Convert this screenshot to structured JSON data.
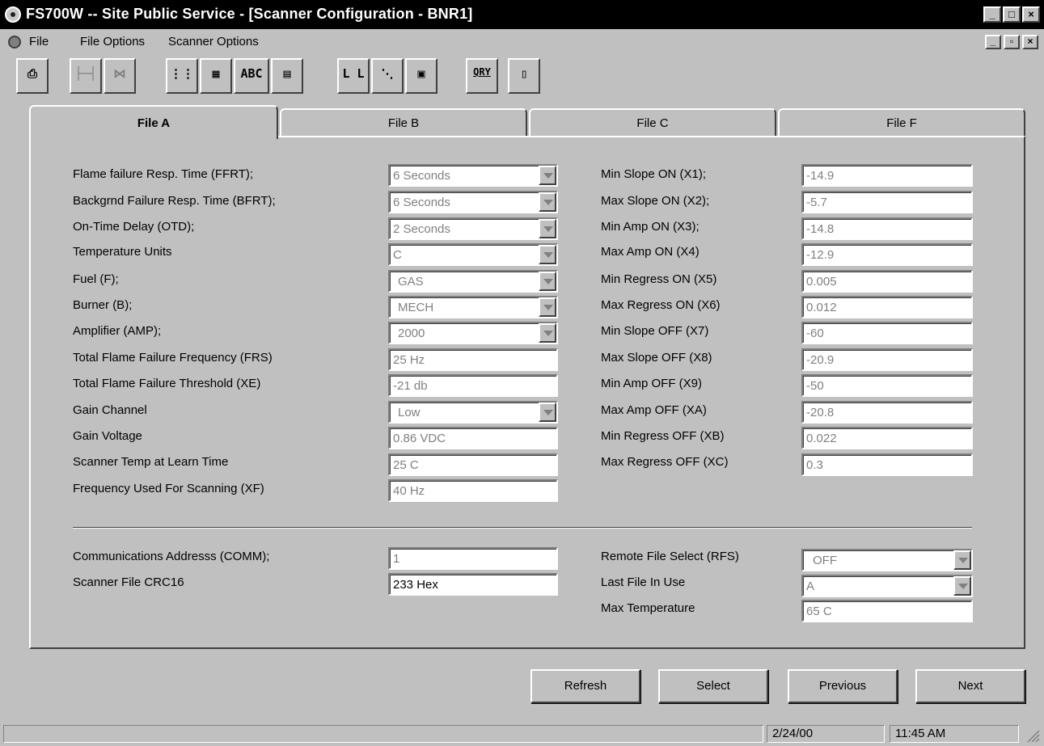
{
  "window": {
    "title": "FS700W -- Site Public Service - [Scanner Configuration - BNR1]",
    "controls": {
      "minimize": "_",
      "maximize": "□",
      "close": "×"
    }
  },
  "menu": {
    "items": [
      "File",
      "File Options",
      "Scanner Options"
    ],
    "mdi_controls": {
      "minimize": "_",
      "restore": "▫",
      "close": "×"
    }
  },
  "toolbar": {
    "buttons": [
      {
        "icon": "printer-icon",
        "glyph": "⎙"
      },
      {
        "icon": "connect-icon",
        "glyph": "├─┤"
      },
      {
        "icon": "disconnect-icon",
        "glyph": "⋈"
      },
      {
        "icon": "list-icon",
        "glyph": "⋮⋮"
      },
      {
        "icon": "data-grid-icon",
        "glyph": "▦"
      },
      {
        "icon": "text-icon",
        "glyph": "ABC"
      },
      {
        "icon": "table-icon",
        "glyph": "▤"
      },
      {
        "icon": "bars-icon",
        "glyph": "L L"
      },
      {
        "icon": "chart-icon",
        "glyph": "⋱"
      },
      {
        "icon": "window-icon",
        "glyph": "▣"
      },
      {
        "icon": "query-icon",
        "glyph": "QRY"
      },
      {
        "icon": "exit-door-icon",
        "glyph": "▯"
      }
    ]
  },
  "tabs": [
    "File A",
    "File B",
    "File C",
    "File F"
  ],
  "left_fields": [
    {
      "label": "Flame failure Resp. Time (FFRT);",
      "value": "6 Seconds",
      "dropdown": true
    },
    {
      "label": "Backgrnd Failure Resp. Time (BFRT);",
      "value": "6 Seconds",
      "dropdown": true
    },
    {
      "label": "On-Time Delay (OTD);",
      "value": "2 Seconds",
      "dropdown": true
    },
    {
      "label": "Temperature Units",
      "value": "C",
      "dropdown": true
    },
    {
      "label": "Fuel (F);",
      "value": "GAS",
      "dropdown": true
    },
    {
      "label": "Burner (B);",
      "value": "MECH",
      "dropdown": true
    },
    {
      "label": "Amplifier (AMP);",
      "value": "2000",
      "dropdown": true
    },
    {
      "label": "Total Flame Failure Frequency (FRS)",
      "value": "25 Hz",
      "dropdown": false
    },
    {
      "label": "Total Flame Failure Threshold (XE)",
      "value": "-21 db",
      "dropdown": false
    },
    {
      "label": "Gain Channel",
      "value": "Low",
      "dropdown": true
    },
    {
      "label": "Gain Voltage",
      "value": "0.86 VDC",
      "dropdown": false
    },
    {
      "label": "Scanner Temp at Learn Time",
      "value": "25 C",
      "dropdown": false
    },
    {
      "label": "Frequency Used For Scanning (XF)",
      "value": "40 Hz",
      "dropdown": false
    }
  ],
  "right_fields": [
    {
      "label": "Min Slope ON (X1);",
      "value": "-14.9"
    },
    {
      "label": "Max Slope ON (X2);",
      "value": "-5.7"
    },
    {
      "label": "Min Amp ON (X3);",
      "value": "-14.8"
    },
    {
      "label": "Max Amp ON (X4)",
      "value": "-12.9"
    },
    {
      "label": "Min Regress ON (X5)",
      "value": "0.005"
    },
    {
      "label": "Max Regress ON (X6)",
      "value": "0.012"
    },
    {
      "label": "Min Slope OFF (X7)",
      "value": "-60"
    },
    {
      "label": "Max Slope OFF (X8)",
      "value": "-20.9"
    },
    {
      "label": "Min Amp OFF (X9)",
      "value": "-50"
    },
    {
      "label": "Max Amp OFF (XA)",
      "value": "-20.8"
    },
    {
      "label": "Min Regress OFF (XB)",
      "value": "0.022"
    },
    {
      "label": "Max Regress OFF (XC)",
      "value": "0.3"
    }
  ],
  "bottom_left": [
    {
      "label": "Communications Addresss (COMM);",
      "value": "1"
    },
    {
      "label": "Scanner File CRC16",
      "value": "233 Hex"
    }
  ],
  "bottom_right": [
    {
      "label": "Remote File Select (RFS)",
      "value": "OFF",
      "dropdown": true
    },
    {
      "label": "Last File In Use",
      "value": "A",
      "dropdown": true
    },
    {
      "label": "Max Temperature",
      "value": "65 C",
      "dropdown": false
    }
  ],
  "buttons": {
    "refresh": "Refresh",
    "select": "Select",
    "previous": "Previous",
    "next": "Next"
  },
  "status": {
    "date": "2/24/00",
    "time": "11:45 AM"
  }
}
